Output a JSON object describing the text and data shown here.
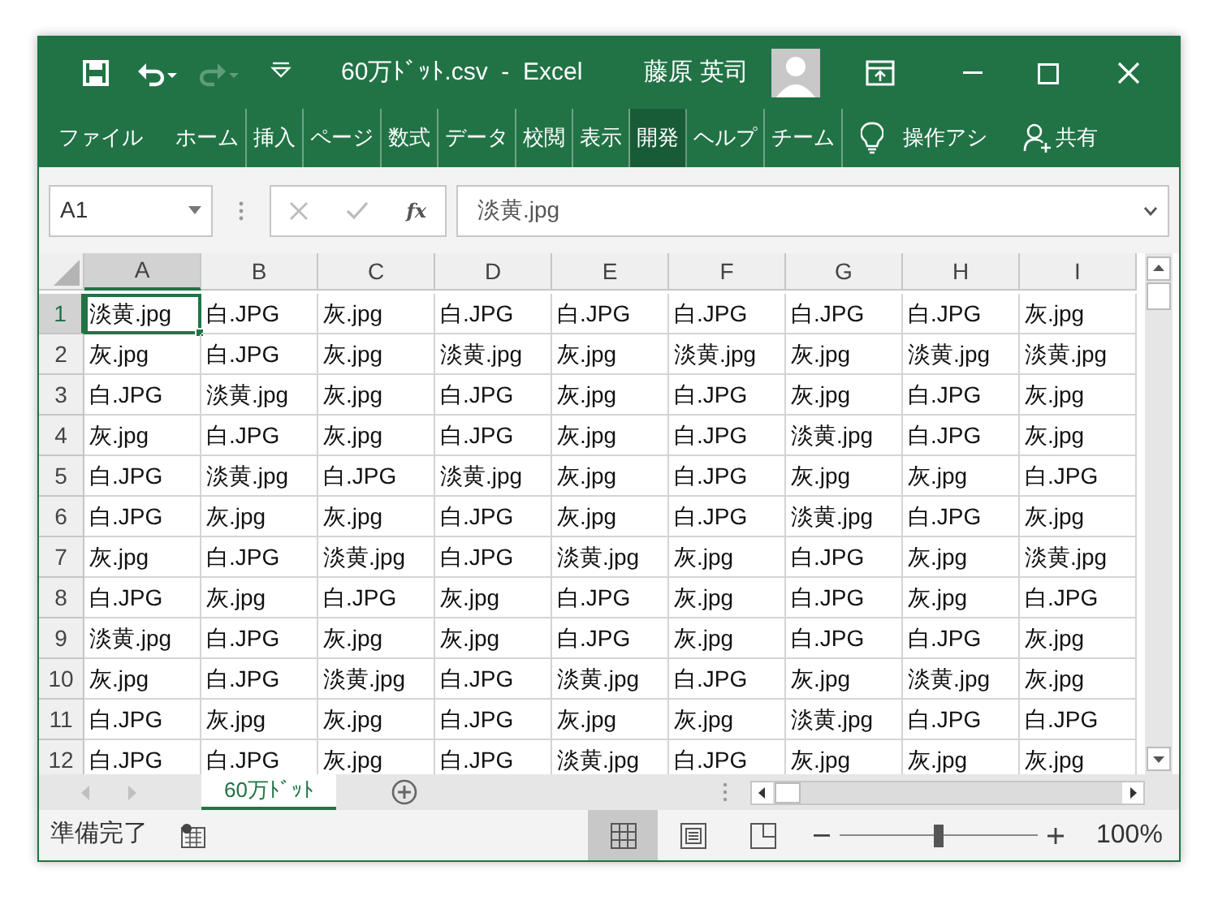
{
  "window": {
    "title": "60万ﾄﾞｯﾄ.csv  -  Excel",
    "user": "藤原 英司"
  },
  "quick_access": [
    {
      "kind": "save",
      "disabled": false
    },
    {
      "kind": "undo",
      "disabled": false
    },
    {
      "kind": "redo",
      "disabled": true
    },
    {
      "kind": "customize",
      "disabled": false
    }
  ],
  "ribbon_tabs": [
    {
      "label": "ファイル",
      "selected": false
    },
    {
      "label": "ホーム",
      "selected": false
    },
    {
      "label": "挿入",
      "selected": false
    },
    {
      "label": "ページ",
      "selected": false
    },
    {
      "label": "数式",
      "selected": false
    },
    {
      "label": "データ",
      "selected": false
    },
    {
      "label": "校閲",
      "selected": false
    },
    {
      "label": "表示",
      "selected": false
    },
    {
      "label": "開発",
      "selected": true
    },
    {
      "label": "ヘルプ",
      "selected": false
    },
    {
      "label": "チーム",
      "selected": false
    }
  ],
  "tell_me": "操作アシ",
  "share": "共有",
  "formula_bar": {
    "name_box": "A1",
    "function_label": "fx",
    "value": "淡黄.jpg"
  },
  "sheet": {
    "columns": [
      {
        "label": "A",
        "selected": true
      },
      {
        "label": "B",
        "selected": false
      },
      {
        "label": "C",
        "selected": false
      },
      {
        "label": "D",
        "selected": false
      },
      {
        "label": "E",
        "selected": false
      },
      {
        "label": "F",
        "selected": false
      },
      {
        "label": "G",
        "selected": false
      },
      {
        "label": "H",
        "selected": false
      },
      {
        "label": "I",
        "selected": false
      }
    ],
    "rows": [
      {
        "label": "1",
        "selected": true,
        "cells": [
          "淡黄.jpg",
          "白.JPG",
          "灰.jpg",
          "白.JPG",
          "白.JPG",
          "白.JPG",
          "白.JPG",
          "白.JPG",
          "灰.jpg"
        ]
      },
      {
        "label": "2",
        "selected": false,
        "cells": [
          "灰.jpg",
          "白.JPG",
          "灰.jpg",
          "淡黄.jpg",
          "灰.jpg",
          "淡黄.jpg",
          "灰.jpg",
          "淡黄.jpg",
          "淡黄.jpg"
        ]
      },
      {
        "label": "3",
        "selected": false,
        "cells": [
          "白.JPG",
          "淡黄.jpg",
          "灰.jpg",
          "白.JPG",
          "灰.jpg",
          "白.JPG",
          "灰.jpg",
          "白.JPG",
          "灰.jpg"
        ]
      },
      {
        "label": "4",
        "selected": false,
        "cells": [
          "灰.jpg",
          "白.JPG",
          "灰.jpg",
          "白.JPG",
          "灰.jpg",
          "白.JPG",
          "淡黄.jpg",
          "白.JPG",
          "灰.jpg"
        ]
      },
      {
        "label": "5",
        "selected": false,
        "cells": [
          "白.JPG",
          "淡黄.jpg",
          "白.JPG",
          "淡黄.jpg",
          "灰.jpg",
          "白.JPG",
          "灰.jpg",
          "灰.jpg",
          "白.JPG"
        ]
      },
      {
        "label": "6",
        "selected": false,
        "cells": [
          "白.JPG",
          "灰.jpg",
          "灰.jpg",
          "白.JPG",
          "灰.jpg",
          "白.JPG",
          "淡黄.jpg",
          "白.JPG",
          "灰.jpg"
        ]
      },
      {
        "label": "7",
        "selected": false,
        "cells": [
          "灰.jpg",
          "白.JPG",
          "淡黄.jpg",
          "白.JPG",
          "淡黄.jpg",
          "灰.jpg",
          "白.JPG",
          "灰.jpg",
          "淡黄.jpg"
        ]
      },
      {
        "label": "8",
        "selected": false,
        "cells": [
          "白.JPG",
          "灰.jpg",
          "白.JPG",
          "灰.jpg",
          "白.JPG",
          "灰.jpg",
          "白.JPG",
          "灰.jpg",
          "白.JPG"
        ]
      },
      {
        "label": "9",
        "selected": false,
        "cells": [
          "淡黄.jpg",
          "白.JPG",
          "灰.jpg",
          "灰.jpg",
          "白.JPG",
          "灰.jpg",
          "白.JPG",
          "白.JPG",
          "灰.jpg"
        ]
      },
      {
        "label": "10",
        "selected": false,
        "cells": [
          "灰.jpg",
          "白.JPG",
          "淡黄.jpg",
          "白.JPG",
          "淡黄.jpg",
          "白.JPG",
          "灰.jpg",
          "淡黄.jpg",
          "灰.jpg"
        ]
      },
      {
        "label": "11",
        "selected": false,
        "cells": [
          "白.JPG",
          "灰.jpg",
          "灰.jpg",
          "白.JPG",
          "灰.jpg",
          "灰.jpg",
          "淡黄.jpg",
          "白.JPG",
          "白.JPG"
        ]
      },
      {
        "label": "12",
        "selected": false,
        "cells": [
          "白.JPG",
          "白.JPG",
          "灰.jpg",
          "白.JPG",
          "淡黄.jpg",
          "白.JPG",
          "灰.jpg",
          "灰.jpg",
          "灰.jpg"
        ]
      }
    ]
  },
  "sheet_tabs": [
    {
      "label": "60万ﾄﾞｯﾄ",
      "selected": true
    }
  ],
  "status_bar": {
    "status": "準備完了",
    "views": [
      {
        "kind": "normal",
        "selected": true
      },
      {
        "kind": "page_layout",
        "selected": false
      },
      {
        "kind": "page_break",
        "selected": false
      }
    ],
    "zoom": {
      "level": 0.5,
      "reading": "100%"
    }
  }
}
